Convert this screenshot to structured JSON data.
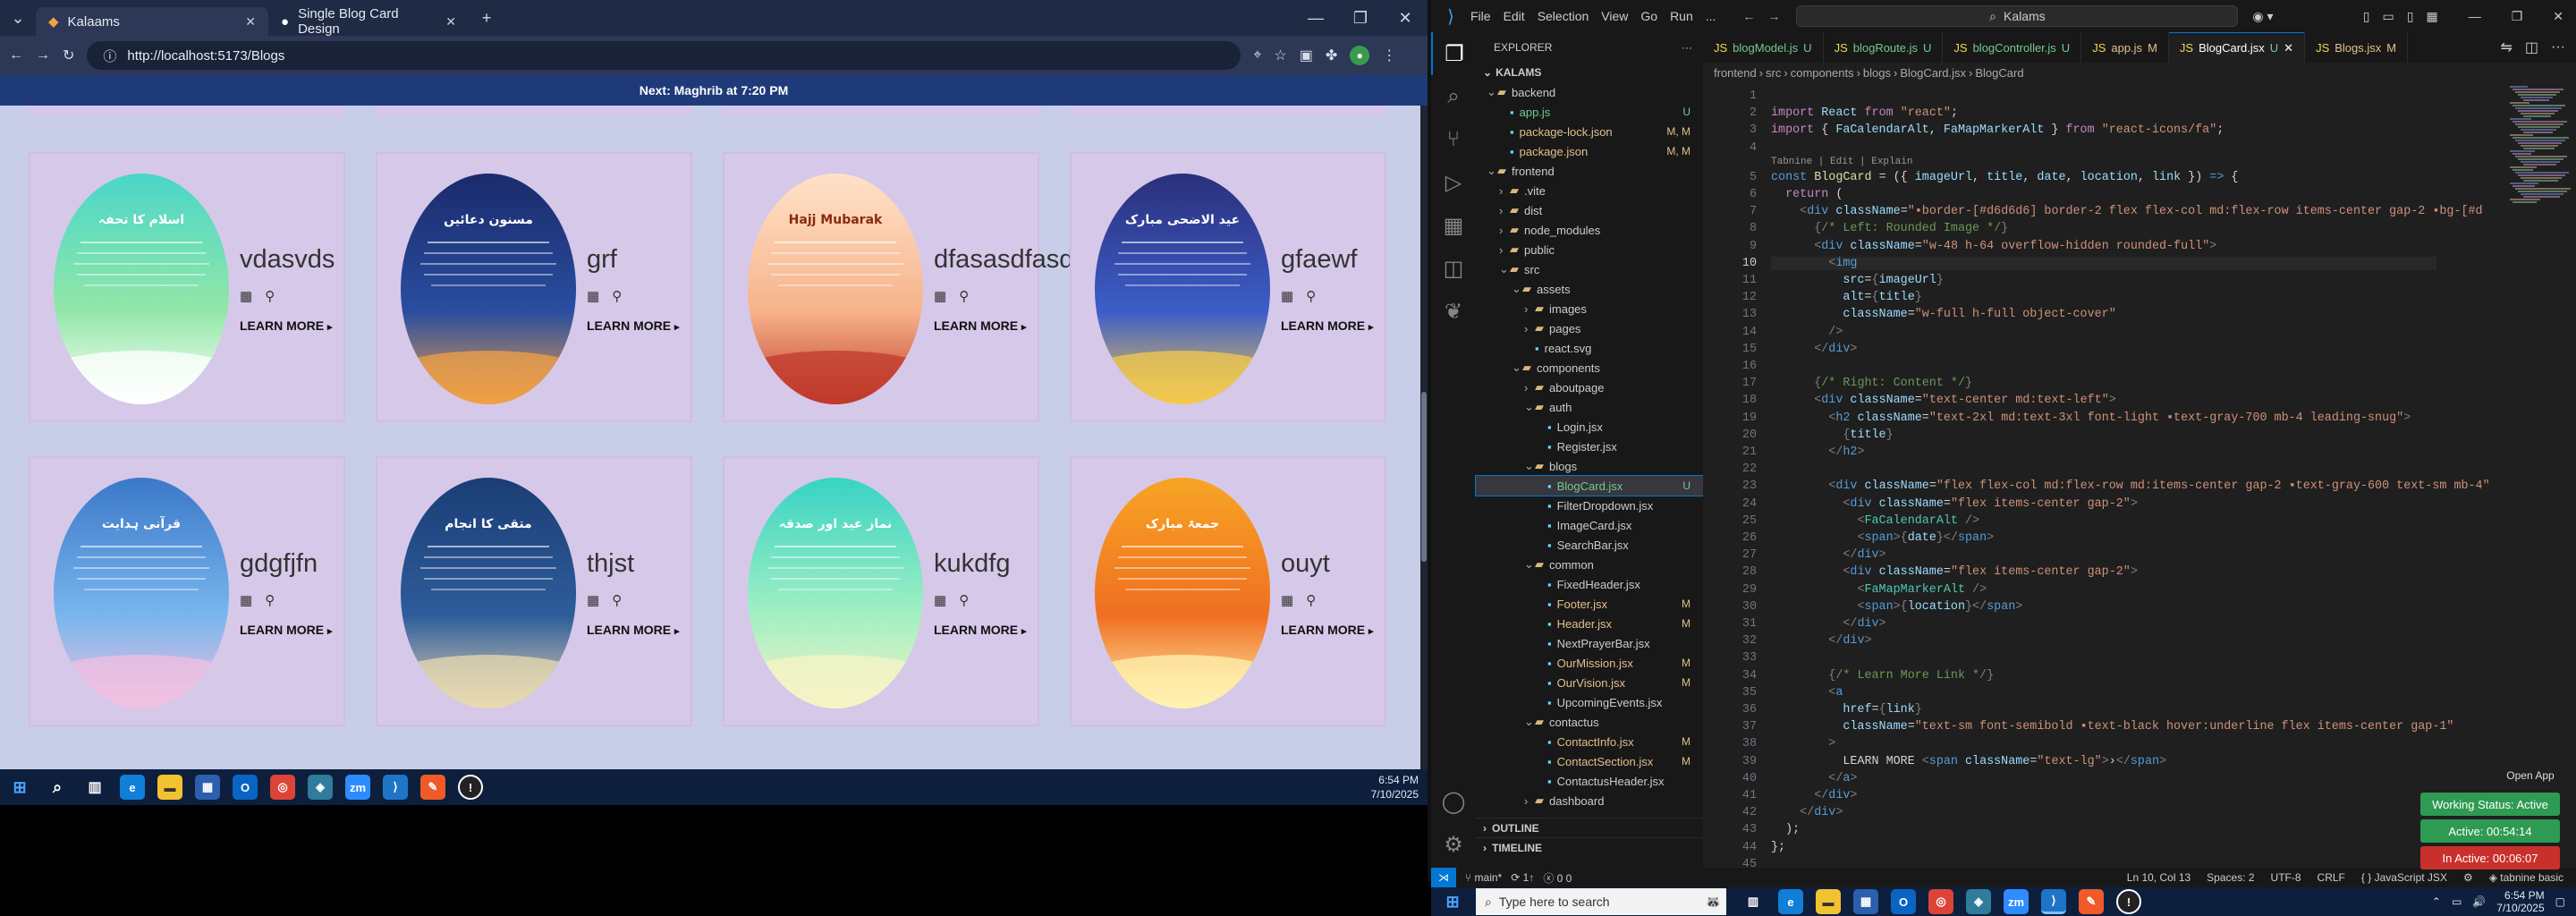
{
  "browser": {
    "tabs": [
      {
        "label": "Kalaams",
        "active": true
      },
      {
        "label": "Single Blog Card Design",
        "active": false
      }
    ],
    "url": "http://localhost:5173/Blogs",
    "prayer_banner": "Next: Maghrib at 7:20 PM",
    "blog_cards": [
      {
        "title": "vdasvds",
        "learn_more": "LEARN MORE",
        "image_palette": [
          "#4ad6c8",
          "#93e7a8",
          "#ffffff"
        ],
        "image_text": "اسلام کا تحفہ"
      },
      {
        "title": "grf",
        "learn_more": "LEARN MORE",
        "image_palette": [
          "#1b2a6b",
          "#2a4ea0",
          "#f0a046"
        ],
        "image_text": "مسنون دعائیں"
      },
      {
        "title": "dfasasdfasd",
        "learn_more": "LEARN MORE",
        "image_palette": [
          "#ffe2c9",
          "#f6b38a",
          "#c0392b"
        ],
        "image_text": "Hajj Mubarak"
      },
      {
        "title": "gfaewf",
        "learn_more": "LEARN MORE",
        "image_palette": [
          "#2b2f7a",
          "#3d5ec9",
          "#f3c94e"
        ],
        "image_text": "عید الاضحی مبارک"
      },
      {
        "title": "gdgfjfn",
        "learn_more": "LEARN MORE",
        "image_palette": [
          "#3b78c8",
          "#79b6ee",
          "#f2c0e0"
        ],
        "image_text": "قرآنی ہدایت"
      },
      {
        "title": "thjst",
        "learn_more": "LEARN MORE",
        "image_palette": [
          "#1b3d75",
          "#2e5d9b",
          "#e9d9b0"
        ],
        "image_text": "متقی کا انجام"
      },
      {
        "title": "kukdfg",
        "learn_more": "LEARN MORE",
        "image_palette": [
          "#38d3c5",
          "#a3f0c3",
          "#f7f3c6"
        ],
        "image_text": "نماز عید اور صدقہ"
      },
      {
        "title": "ouyt",
        "learn_more": "LEARN MORE",
        "image_palette": [
          "#f7a524",
          "#f06f21",
          "#fff3b0"
        ],
        "image_text": "جمعۃ مبارک"
      }
    ]
  },
  "taskbar_left": {
    "time": "6:54 PM",
    "date": "7/10/2025"
  },
  "vscode": {
    "menu": [
      "File",
      "Edit",
      "Selection",
      "View",
      "Go",
      "Run",
      "..."
    ],
    "search_text": "Kalams",
    "explorer_header": "EXPLORER",
    "root": "KALAMS",
    "tree": [
      {
        "label": "backend",
        "indent": 0,
        "type": "folder-open"
      },
      {
        "label": "app.js",
        "indent": 1,
        "type": "file",
        "badge": "U"
      },
      {
        "label": "package-lock.json",
        "indent": 1,
        "type": "file",
        "badge": "M, M"
      },
      {
        "label": "package.json",
        "indent": 1,
        "type": "file",
        "badge": "M, M"
      },
      {
        "label": "frontend",
        "indent": 0,
        "type": "folder-open"
      },
      {
        "label": ".vite",
        "indent": 1,
        "type": "folder"
      },
      {
        "label": "dist",
        "indent": 1,
        "type": "folder"
      },
      {
        "label": "node_modules",
        "indent": 1,
        "type": "folder"
      },
      {
        "label": "public",
        "indent": 1,
        "type": "folder"
      },
      {
        "label": "src",
        "indent": 1,
        "type": "folder-open"
      },
      {
        "label": "assets",
        "indent": 2,
        "type": "folder-open"
      },
      {
        "label": "images",
        "indent": 3,
        "type": "folder"
      },
      {
        "label": "pages",
        "indent": 3,
        "type": "folder"
      },
      {
        "label": "react.svg",
        "indent": 3,
        "type": "file"
      },
      {
        "label": "components",
        "indent": 2,
        "type": "folder-open"
      },
      {
        "label": "aboutpage",
        "indent": 3,
        "type": "folder"
      },
      {
        "label": "auth",
        "indent": 3,
        "type": "folder-open"
      },
      {
        "label": "Login.jsx",
        "indent": 4,
        "type": "file"
      },
      {
        "label": "Register.jsx",
        "indent": 4,
        "type": "file"
      },
      {
        "label": "blogs",
        "indent": 3,
        "type": "folder-open"
      },
      {
        "label": "BlogCard.jsx",
        "indent": 4,
        "type": "file",
        "badge": "U",
        "selected": true
      },
      {
        "label": "FilterDropdown.jsx",
        "indent": 4,
        "type": "file"
      },
      {
        "label": "ImageCard.jsx",
        "indent": 4,
        "type": "file"
      },
      {
        "label": "SearchBar.jsx",
        "indent": 4,
        "type": "file"
      },
      {
        "label": "common",
        "indent": 3,
        "type": "folder-open"
      },
      {
        "label": "FixedHeader.jsx",
        "indent": 4,
        "type": "file"
      },
      {
        "label": "Footer.jsx",
        "indent": 4,
        "type": "file",
        "badge": "M"
      },
      {
        "label": "Header.jsx",
        "indent": 4,
        "type": "file",
        "badge": "M"
      },
      {
        "label": "NextPrayerBar.jsx",
        "indent": 4,
        "type": "file"
      },
      {
        "label": "OurMission.jsx",
        "indent": 4,
        "type": "file",
        "badge": "M"
      },
      {
        "label": "OurVision.jsx",
        "indent": 4,
        "type": "file",
        "badge": "M"
      },
      {
        "label": "UpcomingEvents.jsx",
        "indent": 4,
        "type": "file"
      },
      {
        "label": "contactus",
        "indent": 3,
        "type": "folder-open"
      },
      {
        "label": "ContactInfo.jsx",
        "indent": 4,
        "type": "file",
        "badge": "M"
      },
      {
        "label": "ContactSection.jsx",
        "indent": 4,
        "type": "file",
        "badge": "M"
      },
      {
        "label": "ContactusHeader.jsx",
        "indent": 4,
        "type": "file"
      },
      {
        "label": "dashboard",
        "indent": 3,
        "type": "folder"
      }
    ],
    "outline": "OUTLINE",
    "timeline": "TIMELINE",
    "editor_tabs": [
      {
        "label": "blogModel.js",
        "badge": "U"
      },
      {
        "label": "blogRoute.js",
        "badge": "U"
      },
      {
        "label": "blogController.js",
        "badge": "U"
      },
      {
        "label": "app.js",
        "badge": "M"
      },
      {
        "label": "BlogCard.jsx",
        "badge": "U",
        "active": true
      },
      {
        "label": "Blogs.jsx",
        "badge": "M"
      }
    ],
    "breadcrumb": [
      "frontend",
      "src",
      "components",
      "blogs",
      "BlogCard.jsx",
      "BlogCard"
    ],
    "codelens": "Tabnine | Edit | Explain",
    "status": {
      "branch": "main*",
      "sync": "1↑",
      "problems": "0  0",
      "position": "Ln 10, Col 13",
      "spaces": "Spaces: 2",
      "encoding": "UTF-8",
      "eol": "CRLF",
      "language": "JavaScript JSX",
      "tabnine": "tabnine basic"
    },
    "working_status": "Working Status: Active",
    "active_time": "Active: 00:54:14",
    "inactive_time": "In Active: 00:06:07",
    "open_app": "Open App"
  },
  "taskbar_right": {
    "search_placeholder": "Type here to search",
    "time": "6:54 PM",
    "date": "7/10/2025"
  }
}
